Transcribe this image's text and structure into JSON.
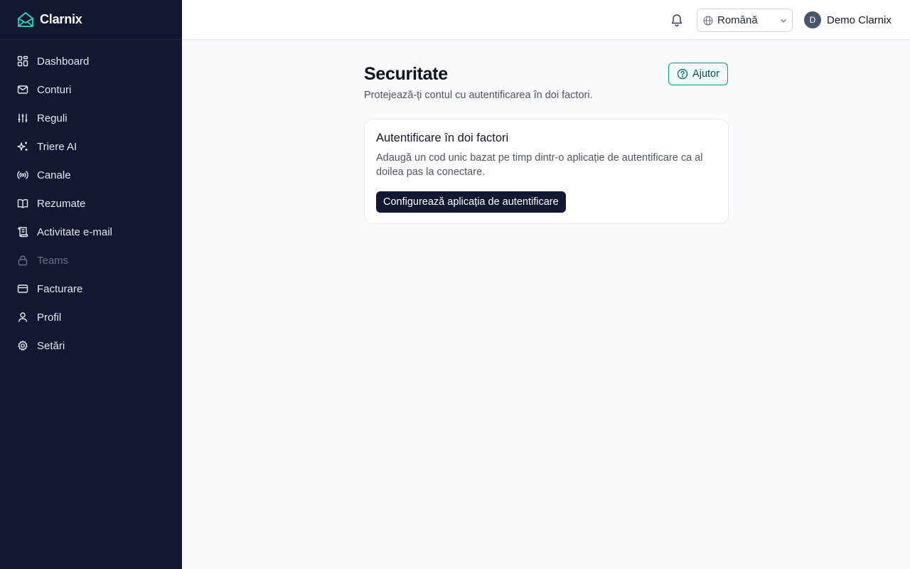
{
  "brand": {
    "name": "Clarnix"
  },
  "sidebar": {
    "items": [
      {
        "label": "Dashboard",
        "icon": "dashboard-icon"
      },
      {
        "label": "Conturi",
        "icon": "mail-icon"
      },
      {
        "label": "Reguli",
        "icon": "sliders-icon"
      },
      {
        "label": "Triere AI",
        "icon": "sparkles-icon"
      },
      {
        "label": "Canale",
        "icon": "radio-icon"
      },
      {
        "label": "Rezumate",
        "icon": "book-open-icon"
      },
      {
        "label": "Activitate e-mail",
        "icon": "scroll-icon"
      },
      {
        "label": "Teams",
        "icon": "lock-icon",
        "disabled": true
      },
      {
        "label": "Facturare",
        "icon": "credit-card-icon"
      },
      {
        "label": "Profil",
        "icon": "user-icon"
      },
      {
        "label": "Setări",
        "icon": "gear-icon"
      }
    ]
  },
  "topbar": {
    "language": "Română",
    "user": {
      "initial": "D",
      "name": "Demo Clarnix"
    }
  },
  "page": {
    "title": "Securitate",
    "subtitle": "Protejează-ți contul cu autentificarea în doi factori.",
    "help_label": "Ajutor"
  },
  "card": {
    "title": "Autentificare în doi factori",
    "description": "Adaugă un cod unic bazat pe timp dintr-o aplicație de autentificare ca al doilea pas la conectare.",
    "button_label": "Configurează aplicația de autentificare"
  },
  "colors": {
    "sidebar_bg": "#111830",
    "accent": "#0d9488",
    "primary_button": "#111830",
    "page_bg": "#f8fafc"
  }
}
